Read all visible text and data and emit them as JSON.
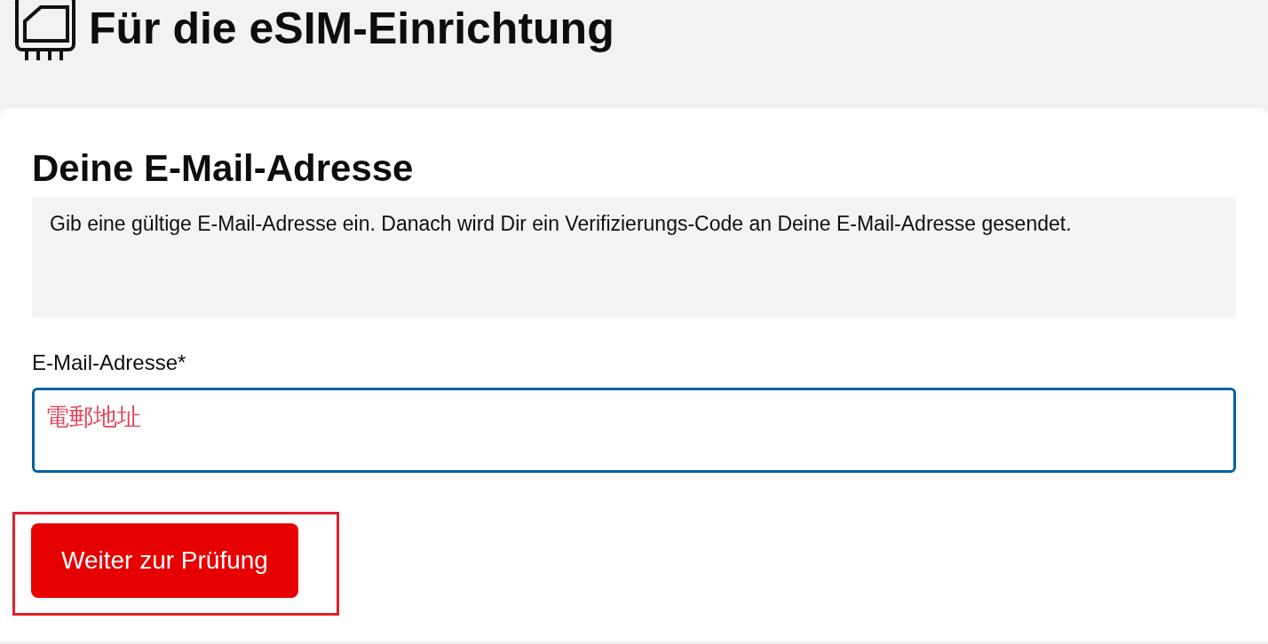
{
  "page_title": "Für die eSIM-Einrichtung",
  "card": {
    "heading": "Deine E-Mail-Adresse",
    "info": "Gib eine gültige E-Mail-Adresse ein. Danach wird Dir ein Verifizierungs-Code an Deine E-Mail-Adresse gesendet.",
    "email_field": {
      "label": "E-Mail-Adresse*",
      "focused": true,
      "annotation": "電郵地址"
    },
    "submit_button": {
      "label": "Weiter zur Prüfung",
      "highlighted": true
    }
  }
}
